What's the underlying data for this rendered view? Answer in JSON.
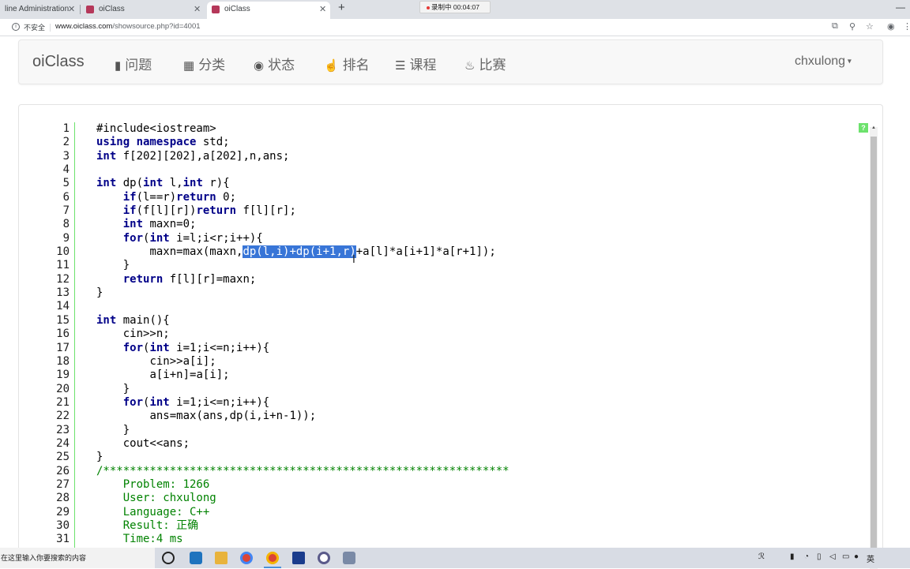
{
  "browser": {
    "tabs": [
      {
        "title": "line Administration"
      },
      {
        "title": "oiClass"
      },
      {
        "title": "oiClass"
      }
    ],
    "recording": "录制中 00:04:07",
    "security_label": "不安全",
    "url_host": "www.oiclass.com",
    "url_path": "/showsource.php?id=4001"
  },
  "navbar": {
    "brand": "oiClass",
    "items": [
      {
        "label": "问题",
        "icon": "book-icon"
      },
      {
        "label": "分类",
        "icon": "grid-icon"
      },
      {
        "label": "状态",
        "icon": "play-circle-icon"
      },
      {
        "label": "排名",
        "icon": "thumbs-up-icon"
      },
      {
        "label": "课程",
        "icon": "list-icon"
      },
      {
        "label": "比赛",
        "icon": "fire-icon"
      }
    ],
    "user": "chxulong"
  },
  "code": {
    "line_numbers": [
      "1",
      "2",
      "3",
      "4",
      "5",
      "6",
      "7",
      "8",
      "9",
      "10",
      "11",
      "12",
      "13",
      "14",
      "15",
      "16",
      "17",
      "18",
      "19",
      "20",
      "21",
      "22",
      "23",
      "24",
      "25",
      "26",
      "27",
      "28",
      "29",
      "30",
      "31"
    ],
    "highlighted_selection": "dp(l,i)+dp(i+1,r)",
    "lines": {
      "l1": "#include<iostream>",
      "l2a": "using namespace",
      "l2b": " std;",
      "l3a": "int",
      "l3b": " f[202][202],a[202],n,ans;",
      "l5a": "int",
      "l5b": " dp(",
      "l5c": "int",
      "l5d": " l,",
      "l5e": "int",
      "l5f": " r){",
      "l6a": "if",
      "l6b": "(l==r)",
      "l6c": "return",
      "l6d": " 0;",
      "l7a": "if",
      "l7b": "(f[l][r])",
      "l7c": "return",
      "l7d": " f[l][r];",
      "l8a": "int",
      "l8b": " maxn=0;",
      "l9a": "for",
      "l9b": "(",
      "l9c": "int",
      "l9d": " i=l;i<r;i++){",
      "l10a": "maxn=max(maxn,",
      "l10b": "dp(l,i)+dp(i+1,r)",
      "l10c": "+a[l]*a[i+1]*a[r+1]);",
      "l11": "}",
      "l12a": "return",
      "l12b": " f[l][r]=maxn;",
      "l13": "}",
      "l15a": "int",
      "l15b": " main(){",
      "l16": "cin>>n;",
      "l17a": "for",
      "l17b": "(",
      "l17c": "int",
      "l17d": " i=1;i<=n;i++){",
      "l18": "cin>>a[i];",
      "l19": "a[i+n]=a[i];",
      "l20": "}",
      "l21a": "for",
      "l21b": "(",
      "l21c": "int",
      "l21d": " i=1;i<=n;i++){",
      "l22": "ans=max(ans,dp(i,i+n-1));",
      "l23": "}",
      "l24": "cout<<ans;",
      "l25": "}",
      "l26": "/*************************************************************",
      "l27": "Problem: 1266",
      "l28": "User: chxulong",
      "l29": "Language: C++",
      "l30": "Result: 正确",
      "l31": "Time:4 ms"
    }
  },
  "help_button": "?",
  "taskbar": {
    "search_placeholder": "在这里输入你要搜索的内容",
    "ime": "英"
  },
  "colors": {
    "keyword": "#000088",
    "comment": "#008200",
    "selection": "#3875d7",
    "gutter": "#6ce26c"
  }
}
